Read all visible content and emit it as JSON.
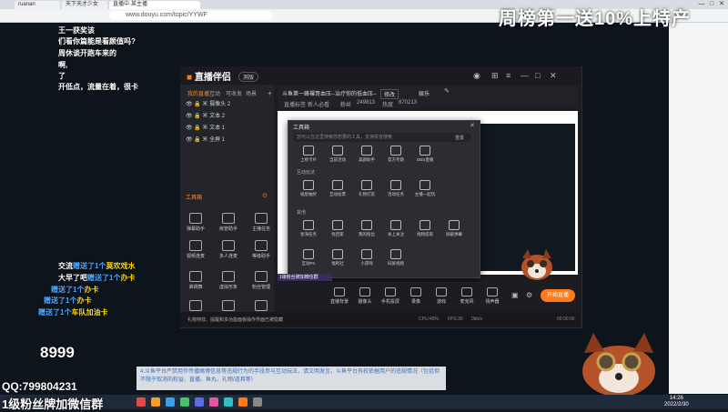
{
  "browser": {
    "tabs": [
      "ruanan",
      "天下天才少女",
      "直播中·某主播"
    ],
    "url": "www.douyu.com/topic/YYWF",
    "window_buttons": [
      "—",
      "□",
      "✕"
    ]
  },
  "overlay": {
    "weekly_banner": "周榜第一送10%上特产",
    "chat_lines": [
      {
        "user": "",
        "text": "王一获奖该"
      },
      {
        "user": "",
        "text": "们看你篇能是看颜值吗?"
      },
      {
        "user": "",
        "text": "周休谈开跑车来的"
      },
      {
        "user": "",
        "text": "啊,"
      },
      {
        "user": "",
        "text": "了"
      },
      {
        "user": "",
        "text": "开低点，流量在着，很卡"
      }
    ],
    "gift_lines": [
      {
        "pre": "交流",
        "gift": "赠送了1个",
        "item": "莫欢戏水"
      },
      {
        "pre": "大早了吧",
        "gift": "赠送了1个",
        "item": "办卡"
      },
      {
        "pre": "",
        "gift": "赠送了1个",
        "item": "办卡"
      },
      {
        "pre": "",
        "gift": "赠送了1个",
        "item": "办卡"
      },
      {
        "pre": "",
        "gift": "赠送了1个",
        "item": "车队加油卡"
      }
    ],
    "phone_fragment": "8999",
    "qq": "QQ:799804231",
    "fan_group": "1级粉丝牌加微信群",
    "bottom_notice": "4.斗鱼平台严禁用作传播赌博信息等违规行为的手段参与互动玩法，请文明发言。斗鱼平台有权依据用户的违规情况（包括但不限于取消的权益、直播、鱼丸、礼物/道具等）"
  },
  "app": {
    "name": "直播伴侣",
    "version_badge": "测版",
    "side_tabs": [
      "我的直播",
      "互动",
      "可收发",
      "场景"
    ],
    "sources": [
      {
        "label": "摄像头 2"
      },
      {
        "label": "文本 2"
      },
      {
        "label": "文本 1"
      },
      {
        "label": "全屏 1"
      }
    ],
    "toolbox_label": "工具箱",
    "toolbox_items": [
      "弹幕助手",
      "房管助手",
      "主播任务",
      "视频连麦",
      "多人连麦",
      "等级助手",
      "谁跳舞",
      "虚拟形象",
      "粉丝管理",
      "PK",
      "",
      ""
    ],
    "header": {
      "room_title": "斗鱼第一峰裸哥血压--治疗你的低血压--",
      "edit": "修改",
      "category": "娱乐",
      "live_tag": "直播标签",
      "tag_value": "新人必看",
      "fans_label": "粉丝",
      "fans": "249813",
      "hot_label": "热度",
      "hot": "870213"
    },
    "dialog": {
      "title": "工具箱",
      "close": "✕",
      "search_placeholder": "您可以在这里搜索您想要的工具，支持拼音搜索",
      "reset": "重置",
      "sections": [
        {
          "label": "",
          "items": [
            "上榜卡片",
            "当前活动",
            "美颜助手",
            "官方专题",
            "OBS直播"
          ]
        },
        {
          "label": "互动玩法",
          "items": [
            "福星抽奖",
            "互动投票",
            "礼物打赏",
            "活动任务",
            "主播一起玩"
          ]
        },
        {
          "label": "其他",
          "items": [
            "星海任务",
            "找回家",
            "我的粉丝",
            "关上关注",
            "视频提取",
            "屏蔽弹幕"
          ]
        },
        {
          "label": "",
          "items": [
            "互动PK",
            "福利社",
            "小游戏",
            "同屏视频"
          ]
        }
      ]
    },
    "purple_label": "1级粉丝牌加微信群",
    "bottom_tools": [
      "直播背景",
      "摄像头",
      "手机投屏",
      "录像",
      "游戏",
      "麦克风",
      "扬声器"
    ],
    "go_live": "开始直播",
    "status_text": "礼物特效、提醒和多功能面板操作界面已被隐藏",
    "status_right": [
      "CPU:40%",
      "FPS:30",
      "0kb/s",
      "00:00:00"
    ]
  },
  "taskbar": {
    "time": "14:26",
    "date": "2022/2/30"
  },
  "colors": {
    "accent": "#ff7a1a",
    "gift_yellow": "#ffd900",
    "gift_blue": "#4fa8ff"
  }
}
